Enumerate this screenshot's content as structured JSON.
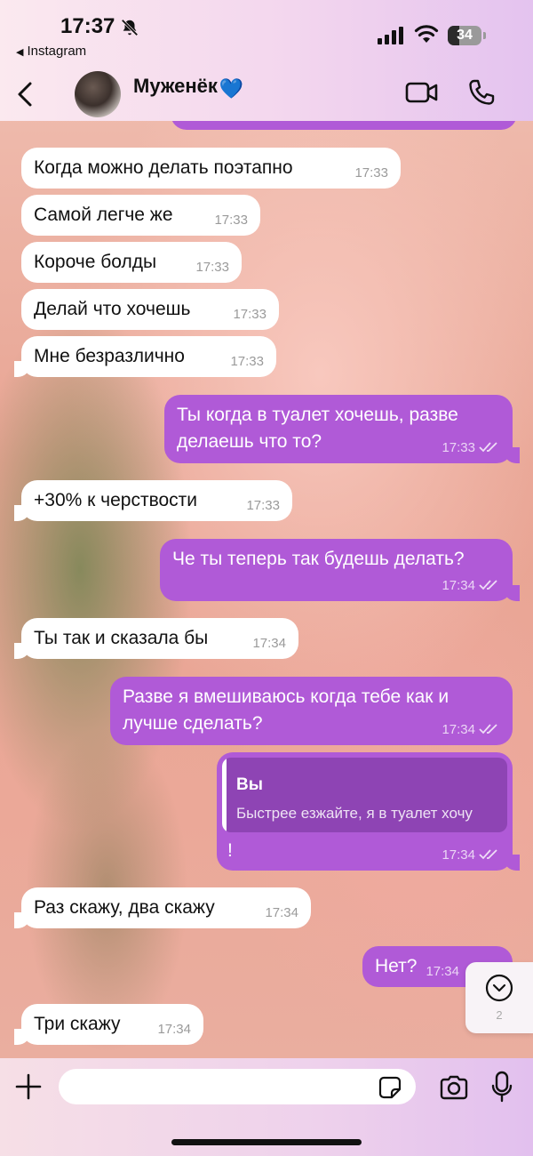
{
  "status_bar": {
    "time": "17:37",
    "back_app": "Instagram",
    "battery_percent": "34",
    "battery_level": 0.34
  },
  "header": {
    "contact_name": "Муженёк",
    "contact_emoji": "💙",
    "icons": [
      "back-chevron",
      "video-camera",
      "phone"
    ]
  },
  "messages": [
    {
      "dir": "in",
      "text": "Когда можно делать поэтапно",
      "time": "17:33"
    },
    {
      "dir": "in",
      "text": "Самой легче же",
      "time": "17:33"
    },
    {
      "dir": "in",
      "text": "Короче болды",
      "time": "17:33"
    },
    {
      "dir": "in",
      "text": "Делай что хочешь",
      "time": "17:33"
    },
    {
      "dir": "in",
      "text": "Мне безразлично",
      "time": "17:33"
    },
    {
      "dir": "out",
      "line1": "Ты когда в туалет хочешь, разве",
      "line2": "делаешь что то?",
      "time": "17:33"
    },
    {
      "dir": "in",
      "text": "+30% к черствости",
      "time": "17:33"
    },
    {
      "dir": "out",
      "text": "Че ты теперь так будешь делать?",
      "time": "17:34"
    },
    {
      "dir": "in",
      "text": "Ты так и сказала бы",
      "time": "17:34"
    },
    {
      "dir": "out",
      "line1": "Разве я вмешиваюсь когда тебе как и",
      "line2": "лучше сделать?",
      "time": "17:34"
    },
    {
      "dir": "out",
      "reply_author": "Вы",
      "reply_text": "Быстрее езжайте, я в туалет хочу",
      "text": "!",
      "time": "17:34"
    },
    {
      "dir": "in",
      "text": "Раз скажу, два скажу",
      "time": "17:34"
    },
    {
      "dir": "out",
      "text": "Нет?",
      "time": "17:34"
    },
    {
      "dir": "in",
      "text": "Три скажу",
      "time": "17:34"
    }
  ],
  "scroll_down": {
    "unread_count": "2"
  },
  "composer": {
    "placeholder": ""
  },
  "colors": {
    "outgoing_bubble": "#b05ad7",
    "incoming_bubble": "#ffffff",
    "reply_box": "#8e44b4",
    "header_bg": "#f3d6ee"
  }
}
